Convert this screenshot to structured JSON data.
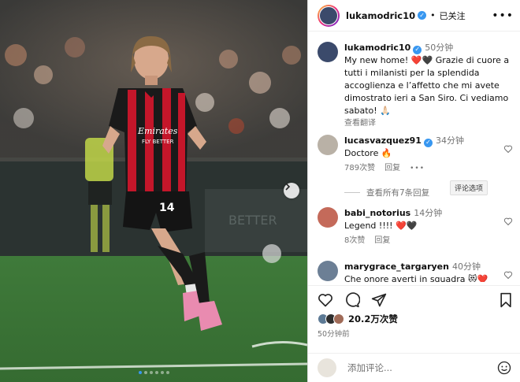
{
  "post": {
    "author": "lukamodric10",
    "follow_status": "已关注",
    "caption_time": "50分钟",
    "caption": "My new home! ❤️🖤 Grazie di cuore a tutti i milanisti per la splendida accoglienza e l’affetto che mi avete dimostrato ieri a San Siro. Ci vediamo sabato! 🙏🏻",
    "translate_label": "查看翻译",
    "likes": "20.2万次赞",
    "posted_ago": "50分钟前",
    "jersey_sponsor": "Emirates\nFLY BETTER",
    "jersey_number": "14"
  },
  "comments": [
    {
      "user": "lucasvazquez91",
      "verified": true,
      "time": "34分钟",
      "text": "Doctore 🔥",
      "likes": "789次赞",
      "reply": "回复"
    },
    {
      "user": "babi_notorius",
      "verified": false,
      "time": "14分钟",
      "text": "Legend !!!! ❤️🖤",
      "likes": "8次赞",
      "reply": "回复"
    },
    {
      "user": "marygrace_targaryen",
      "verified": false,
      "time": "40分钟",
      "text": "Che onore averti in squadra 😻❤️",
      "likes": "",
      "reply": ""
    }
  ],
  "view_replies": "查看所有7条回复",
  "comment_options_tooltip": "评论选项",
  "add_comment_placeholder": "添加评论...",
  "colors": {
    "accent": "#3897f0",
    "muted": "#737373",
    "heart": "#ed4956"
  }
}
